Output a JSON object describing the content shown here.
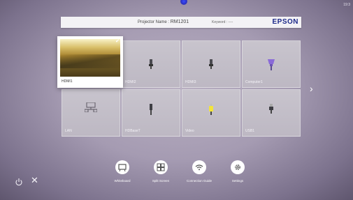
{
  "status": {
    "clock": "19:3"
  },
  "header": {
    "projector_label": "Projector Name : ",
    "projector_name": "RM1201",
    "keyword": "Keyword : ----",
    "brand": "EPSON"
  },
  "sources": [
    {
      "label": "HDMI1",
      "icon": "video-preview",
      "selected": true
    },
    {
      "label": "HDMI2",
      "icon": "hdmi-plug-icon"
    },
    {
      "label": "HDMI3",
      "icon": "hdmi-plug-icon"
    },
    {
      "label": "Computer1",
      "icon": "vga-plug-icon"
    },
    {
      "label": "LAN",
      "icon": "lan-icon"
    },
    {
      "label": "HDBaseT",
      "icon": "hdbaset-plug-icon"
    },
    {
      "label": "Video",
      "icon": "rca-plug-icon"
    },
    {
      "label": "USB1",
      "icon": "usb-plug-icon"
    }
  ],
  "dock": [
    {
      "label": "Whiteboard",
      "icon": "whiteboard-icon"
    },
    {
      "label": "Split Screen",
      "icon": "split-screen-icon"
    },
    {
      "label": "Connection Guide",
      "icon": "wifi-icon"
    },
    {
      "label": "Settings",
      "icon": "gear-icon"
    }
  ],
  "colors": {
    "brand": "#1d2a8a",
    "video_plug": "#f2e43c",
    "vga_plug": "#8a6ad8"
  }
}
